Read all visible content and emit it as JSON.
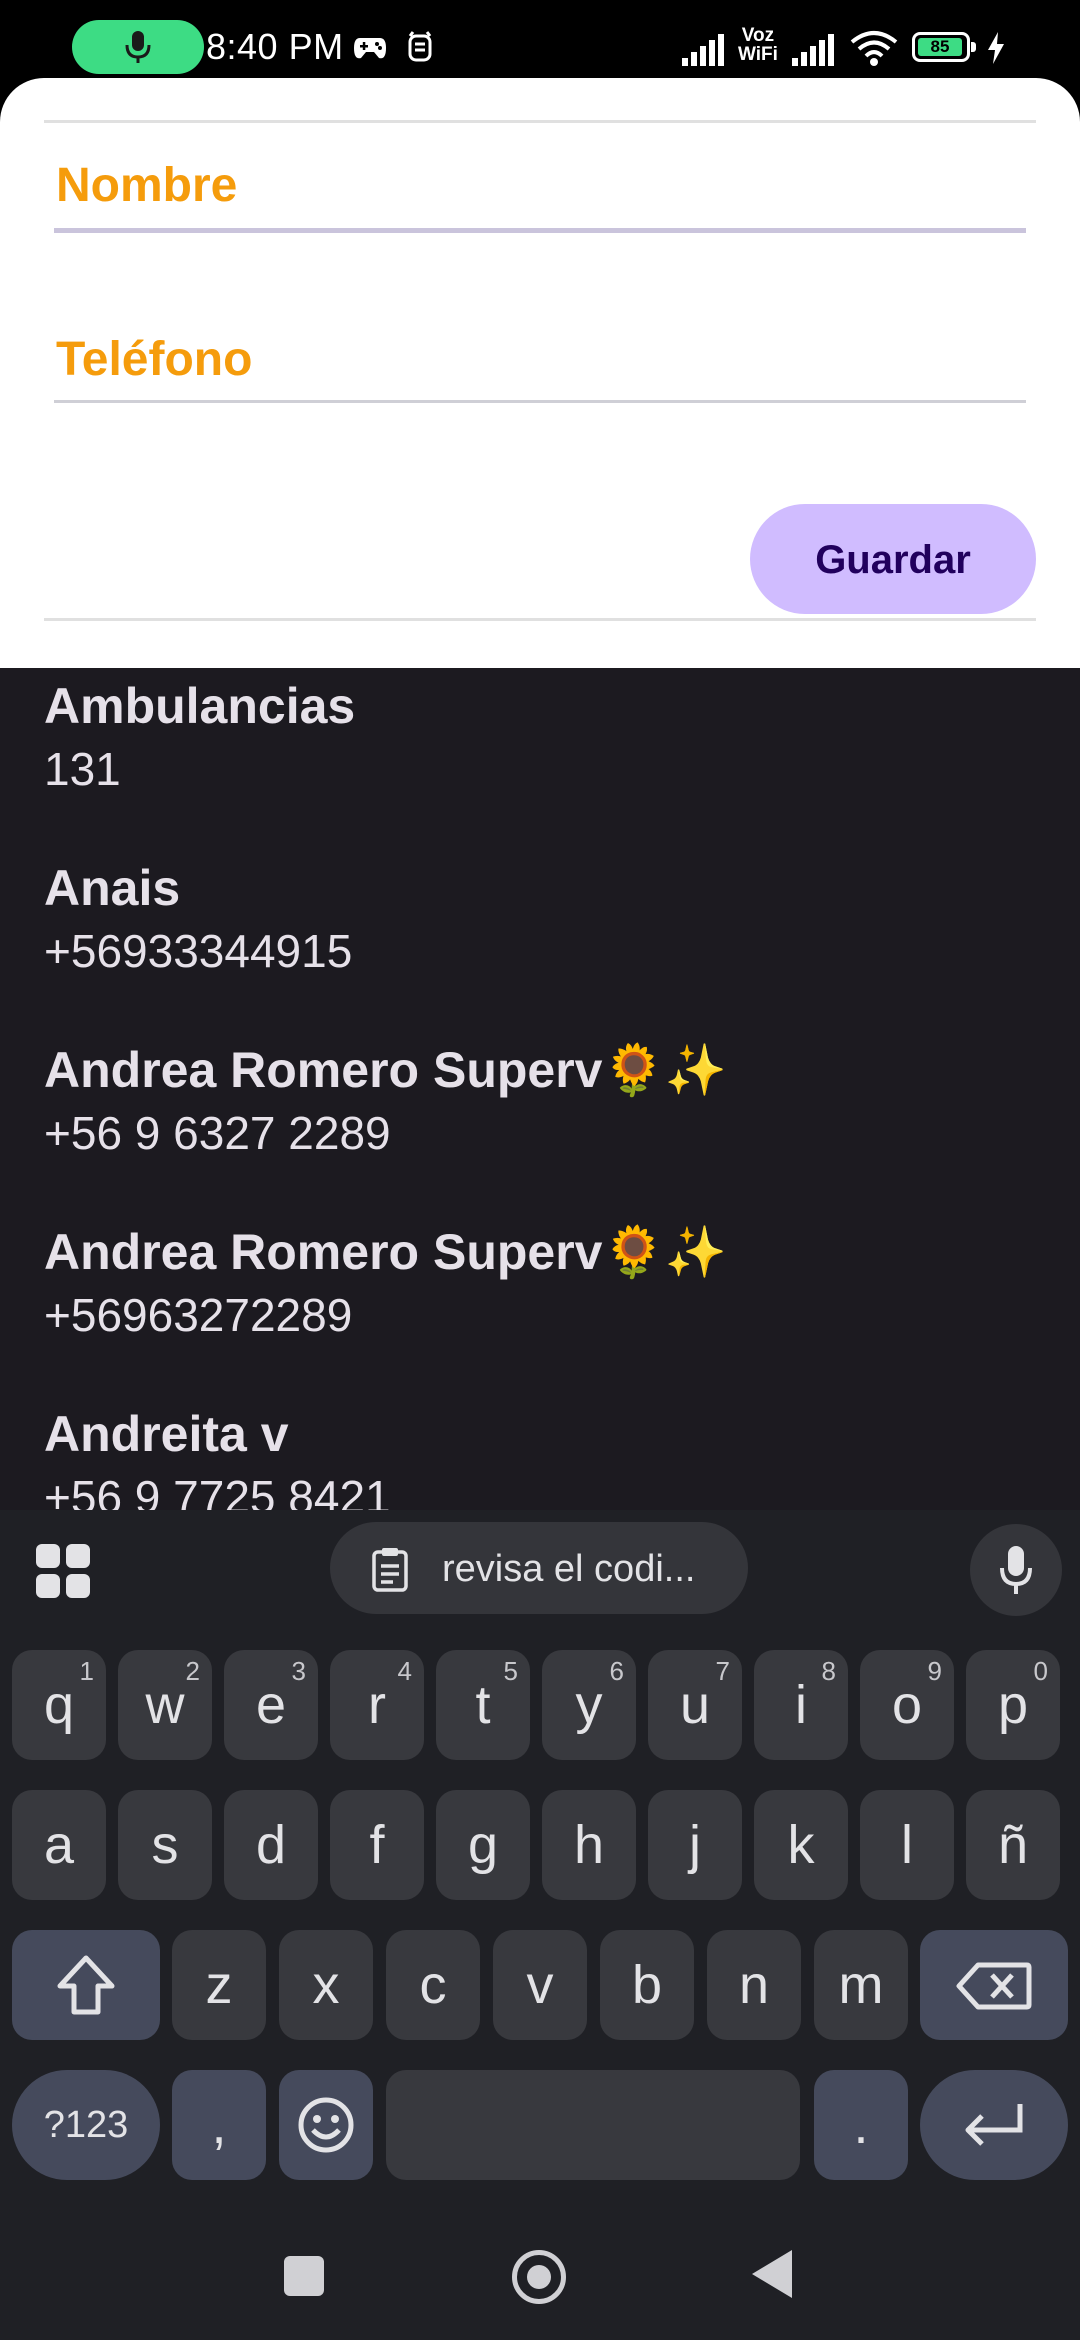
{
  "status_bar": {
    "time": "8:40 PM",
    "network_label": "Voz WiFi",
    "network_label_line1": "Voz",
    "network_label_line2": "WiFi",
    "battery": "85"
  },
  "form": {
    "name_label": "Nombre",
    "phone_label": "Teléfono",
    "save_button": "Guardar",
    "accent_color": "#f59c0c",
    "button_color": "#d0bcff"
  },
  "contacts": [
    {
      "name": "Ambulancias",
      "phone": "131"
    },
    {
      "name": "Anais",
      "phone": "+56933344915"
    },
    {
      "name": "Andrea Romero Superv🌻✨",
      "phone": "+56 9 6327 2289"
    },
    {
      "name": "Andrea Romero Superv🌻✨",
      "phone": "+56963272289"
    },
    {
      "name": "Andreita v",
      "phone": "+56 9 7725 8421"
    }
  ],
  "keyboard": {
    "clipboard_suggestion": "revisa el codi...",
    "row1": [
      {
        "key": "q",
        "hint": "1"
      },
      {
        "key": "w",
        "hint": "2"
      },
      {
        "key": "e",
        "hint": "3"
      },
      {
        "key": "r",
        "hint": "4"
      },
      {
        "key": "t",
        "hint": "5"
      },
      {
        "key": "y",
        "hint": "6"
      },
      {
        "key": "u",
        "hint": "7"
      },
      {
        "key": "i",
        "hint": "8"
      },
      {
        "key": "o",
        "hint": "9"
      },
      {
        "key": "p",
        "hint": "0"
      }
    ],
    "row2": [
      "a",
      "s",
      "d",
      "f",
      "g",
      "h",
      "j",
      "k",
      "l",
      "ñ"
    ],
    "row3": [
      "z",
      "x",
      "c",
      "v",
      "b",
      "n",
      "m"
    ],
    "symbols_key": "?123",
    "comma_key": ",",
    "period_key": "."
  },
  "icons": {
    "status": [
      "mic-icon",
      "game-controller-icon",
      "alarm-icon",
      "signal-icon",
      "wifi-icon",
      "battery-icon",
      "charging-icon"
    ],
    "keyboard": [
      "apps-grid-icon",
      "clipboard-icon",
      "microphone-icon",
      "shift-icon",
      "backspace-icon",
      "emoji-icon",
      "enter-icon"
    ],
    "nav": [
      "recents-icon",
      "home-icon",
      "back-icon"
    ]
  }
}
